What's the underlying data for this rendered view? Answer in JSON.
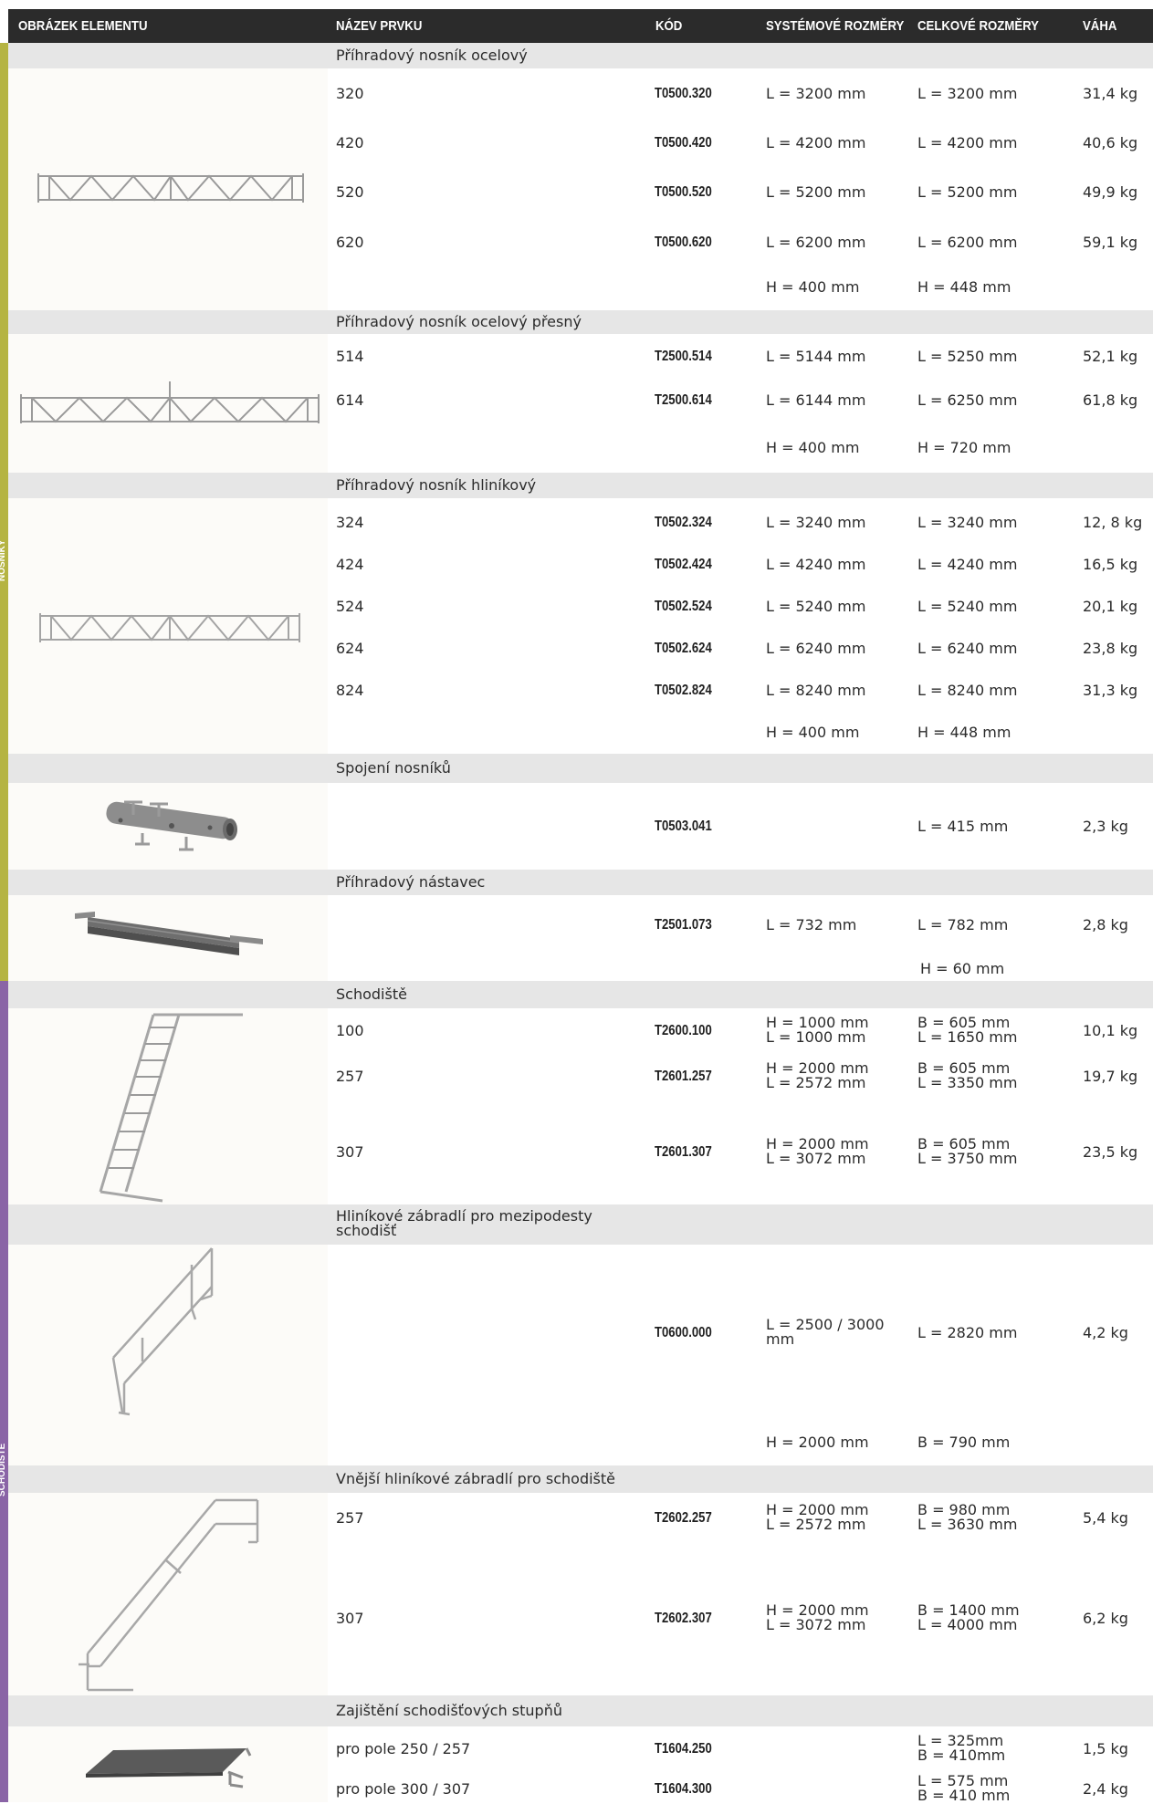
{
  "header": {
    "col_image": "OBRÁZEK ELEMENTU",
    "col_name": "NÁZEV PRVKU",
    "col_code": "KÓD",
    "col_sys": "SYSTÉMOVÉ ROZMĚRY",
    "col_total": "CELKOVÉ ROZMĚRY",
    "col_weight": "VÁHA"
  },
  "sidebar": {
    "section1": "NOSNÍKY",
    "section2": "SCHODIŠTĚ",
    "color1": "#b5b442",
    "color2": "#8a64a6"
  },
  "groups": [
    {
      "title": "Příhradový nosník ocelový",
      "icon": "steel-truss-beam-image",
      "rows": [
        {
          "name": "320",
          "code": "T0500.320",
          "sys": "L = 3200 mm",
          "total": "L = 3200 mm",
          "weight": "31,4 kg"
        },
        {
          "name": "420",
          "code": "T0500.420",
          "sys": "L = 4200 mm",
          "total": "L = 4200 mm",
          "weight": "40,6 kg"
        },
        {
          "name": "520",
          "code": "T0500.520",
          "sys": "L = 5200 mm",
          "total": "L = 5200 mm",
          "weight": "49,9 kg"
        },
        {
          "name": "620",
          "code": "T0500.620",
          "sys": "L = 6200 mm",
          "total": "L = 6200 mm",
          "weight": "59,1 kg"
        },
        {
          "name": "",
          "code": "",
          "sys": "H = 400 mm",
          "total": "H = 448 mm",
          "weight": ""
        }
      ]
    },
    {
      "title": "Příhradový nosník ocelový přesný",
      "icon": "precise-steel-truss-beam-image",
      "rows": [
        {
          "name": "514",
          "code": "T2500.514",
          "sys": "L = 5144 mm",
          "total": "L = 5250 mm",
          "weight": "52,1 kg"
        },
        {
          "name": "614",
          "code": "T2500.614",
          "sys": "L = 6144 mm",
          "total": "L = 6250 mm",
          "weight": "61,8 kg"
        },
        {
          "name": "",
          "code": "",
          "sys": "H = 400 mm",
          "total": "H = 720 mm",
          "weight": ""
        }
      ]
    },
    {
      "title": "Příhradový nosník hliníkový",
      "icon": "aluminium-truss-beam-image",
      "rows": [
        {
          "name": "324",
          "code": "T0502.324",
          "sys": "L = 3240 mm",
          "total": "L = 3240 mm",
          "weight": "12, 8 kg"
        },
        {
          "name": "424",
          "code": "T0502.424",
          "sys": "L = 4240 mm",
          "total": "L = 4240 mm",
          "weight": "16,5 kg"
        },
        {
          "name": "524",
          "code": "T0502.524",
          "sys": "L = 5240 mm",
          "total": "L = 5240 mm",
          "weight": "20,1 kg"
        },
        {
          "name": "624",
          "code": "T0502.624",
          "sys": "L = 6240 mm",
          "total": "L = 6240 mm",
          "weight": "23,8 kg"
        },
        {
          "name": "824",
          "code": "T0502.824",
          "sys": "L = 8240 mm",
          "total": "L = 8240 mm",
          "weight": "31,3 kg"
        },
        {
          "name": "",
          "code": "",
          "sys": "H = 400 mm",
          "total": "H = 448 mm",
          "weight": ""
        }
      ]
    },
    {
      "title": "Spojení nosníků",
      "icon": "beam-coupler-image",
      "rows": [
        {
          "name": "",
          "code": "T0503.041",
          "sys": "",
          "total": "L = 415 mm",
          "weight": "2,3 kg"
        }
      ]
    },
    {
      "title": "Příhradový nástavec",
      "icon": "truss-extension-image",
      "rows": [
        {
          "name": "",
          "code": "T2501.073",
          "sys": "L = 732 mm",
          "total": "L = 782 mm",
          "weight": "2,8 kg"
        },
        {
          "name": "",
          "code": "",
          "sys": "",
          "total": "H = 60 mm",
          "weight": ""
        }
      ]
    },
    {
      "title": "Schodiště",
      "icon": "staircase-image",
      "rows": [
        {
          "name": "100",
          "code": "T2600.100",
          "sys": "H = 1000 mm\nL = 1000 mm",
          "total": "B = 605 mm\nL = 1650 mm",
          "weight": "10,1 kg"
        },
        {
          "name": "257",
          "code": "T2601.257",
          "sys": "H = 2000 mm\nL = 2572 mm",
          "total": "B = 605 mm\nL = 3350 mm",
          "weight": "19,7 kg"
        },
        {
          "name": "307",
          "code": "T2601.307",
          "sys": "H = 2000 mm\nL = 3072 mm",
          "total": "B = 605 mm\nL = 3750 mm",
          "weight": "23,5 kg"
        }
      ]
    },
    {
      "title": "Hliníkové zábradlí pro mezipodesty\nschodišť",
      "icon": "landing-railing-image",
      "rows": [
        {
          "name": "",
          "code": "T0600.000",
          "sys": "L = 2500 / 3000\nmm",
          "total": "L = 2820 mm",
          "weight": "4,2 kg"
        },
        {
          "name": "",
          "code": "",
          "sys": "H = 2000 mm",
          "total": "B = 790 mm",
          "weight": ""
        }
      ]
    },
    {
      "title": "Vnější hliníkové zábradlí pro schodiště",
      "icon": "outer-stair-railing-image",
      "rows": [
        {
          "name": "257",
          "code": "T2602.257",
          "sys": "H = 2000 mm\nL = 2572 mm",
          "total": "B = 980 mm\nL = 3630 mm",
          "weight": "5,4 kg"
        },
        {
          "name": "307",
          "code": "T2602.307",
          "sys": "H = 2000 mm\nL = 3072 mm",
          "total": "B = 1400 mm\nL = 4000 mm",
          "weight": "6,2 kg"
        }
      ]
    },
    {
      "title": "Zajištění schodišťových stupňů",
      "icon": "stair-step-securing-image",
      "rows": [
        {
          "name": "pro pole 250 / 257",
          "code": "T1604.250",
          "sys": "",
          "total": "L = 325mm\nB = 410mm",
          "weight": "1,5 kg"
        },
        {
          "name": "pro pole 300 / 307",
          "code": "T1604.300",
          "sys": "",
          "total": "L = 575 mm\nB = 410 mm",
          "weight": "2,4 kg"
        }
      ]
    }
  ]
}
